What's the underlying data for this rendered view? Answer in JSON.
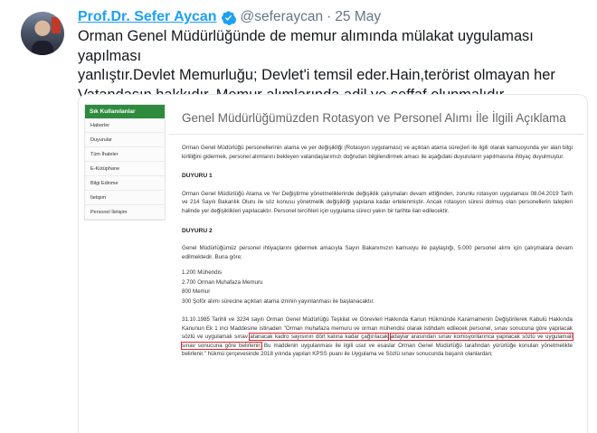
{
  "tweet": {
    "author_name": "Prof.Dr. Sefer Aycan",
    "handle": "@seferaycan",
    "separator": "·",
    "date": "25 May",
    "text_lines": [
      "Orman Genel Müdürlüğünde de memur alımında mülakat uygulaması yapılması",
      "yanlıştır.Devlet Memurluğu; Devlet'i temsil eder.Hain,terörist olmayan her",
      "Vatandaşın hakkıdır. Memur alımlarında adil ve şeffaf olunmalıdır."
    ]
  },
  "screenshot": {
    "sidebar_title": "Sık Kullanılanlar",
    "sidebar_items": [
      "Haberler",
      "Duyurular",
      "Tüm İhaleler",
      "E-Kütüphane",
      "Bilgi Edinme",
      "İletişim",
      "Personel İletişim"
    ],
    "heading": "Genel Müdürlüğümüzden Rotasyon ve Personel Alımı İle İlgili Açıklama",
    "intro": "Orman Genel Müdürlüğü personellerinin atama ve yer değişikliği (Rotasyon uygulaması) ve açıktan atama süreçleri ile ilgili olarak kamuoyunda yer alan bilgi kirliliğini gidermek, personel alımlarını bekleyen vatandaşlarımızı doğrudan bilgilendirmek amacı ile aşağıdaki duyuruların yapılmasına ihtiyaç duyulmuştur.",
    "duyuru1_title": "DUYURU 1",
    "duyuru1_text": "Orman Genel Müdürlüğü Atama ve Yer Değiştirme yönetmeliklerinde değişiklik çalışmaları devam ettiğinden, zorunlu rotasyon uygulaması 08.04.2019 Tarih ve 214 Sayılı Bakanlık Oluru ile söz konusu yönetmelik değişikliği yapılana kadar ertelenmiştir. Ancak rotasyon süresi dolmuş olan personellerin talepleri halinde yer değişiklikleri yapılacaktır. Personel tercihleri için uygulama süreci yakın bir tarihte ilan edilecektir.",
    "duyuru2_title": "DUYURU 2",
    "duyuru2_text": "Genel Müdürlüğümüz personel ihtiyaçlarını gidermek amacıyla Sayın Bakanımızın kamuoyu ile paylaştığı, 5.000 personel alımı için çalışmalara devam edilmektedir. Buna göre;",
    "list": [
      "1.200 Mühendis",
      "2.700 Orman Muhafaza Memuru",
      "800 Memur",
      "300 Şoför alımı sürecine açıktan atama izninin yayınlanması ile başlanacaktır."
    ],
    "final_before": "31.10.1985 Tarihli ve 3234 sayılı Orman Genel Müdürlüğü Teşkilat ve Görevleri Hakkında Kanun Hükmünde Kararnamenin Değiştirilerek Kabulü Hakkında Kanunun Ek 1 inci Maddesine istinaden \"Orman muhafaza memuru ve orman mühendisi olarak istihdam edilecek personel, sınav sonucuna göre yapılacak sözlü ve uygulamalı sınav",
    "final_highlight_a": "atanacak kadro sayısının dört katına kadar çağırılacak",
    "final_highlight_b": "adaylar arasından sınav komisyonlarınca yapılacak sözlü ve uygulamalı sınav sonucuna göre belirlenir.",
    "final_after": "Bu maddenin uygulanması ile ilgili usul ve esaslar Orman Genel Müdürlüğü tarafından yürürlüğe konulan yönetmelikte belirlenir.\" hükmü çerçevesinde 2018 yılında yapılan KPSS puanı ile Uygulama ve Sözlü sınav sonucunda başarılı olanlardan;"
  },
  "colors": {
    "link_blue": "#1da1f2",
    "muted": "#657786",
    "highlight_red": "#e3262b",
    "sidebar_green": "#2e8b3e"
  }
}
